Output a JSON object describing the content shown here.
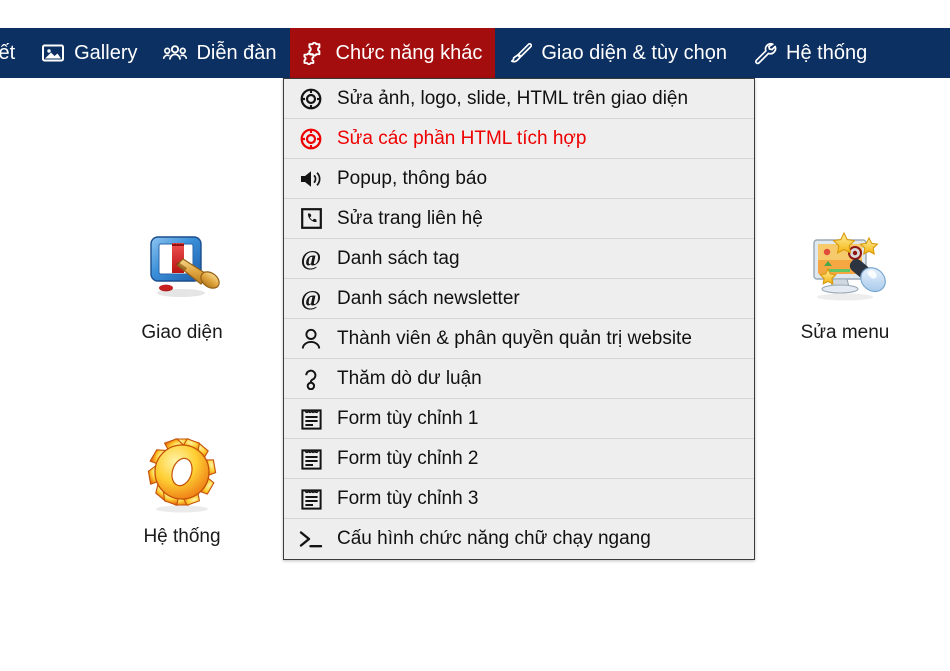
{
  "navbar": {
    "background_color": "#0d3062",
    "active_color": "#a40d0d",
    "items": [
      {
        "label": "iết",
        "icon": "none",
        "active": false
      },
      {
        "label": "Gallery",
        "icon": "image-icon",
        "active": false
      },
      {
        "label": "Diễn đàn",
        "icon": "users-icon",
        "active": false
      },
      {
        "label": "Chức năng khác",
        "icon": "puzzle-icon",
        "active": true
      },
      {
        "label": "Giao diện & tùy chọn",
        "icon": "brush-icon",
        "active": false
      },
      {
        "label": "Hệ thống",
        "icon": "wrench-icon",
        "active": false
      }
    ]
  },
  "dropdown": {
    "owner": "Chức năng khác",
    "highlight_color": "#ee0000",
    "items": [
      {
        "label": "Sửa ảnh, logo, slide, HTML trên giao diện",
        "icon": "lifebuoy-icon",
        "highlighted": false
      },
      {
        "label": "Sửa các phần HTML tích hợp",
        "icon": "lifebuoy-icon",
        "highlighted": true
      },
      {
        "label": "Popup, thông báo",
        "icon": "speaker-icon",
        "highlighted": false
      },
      {
        "label": "Sửa trang liên hệ",
        "icon": "phone-box-icon",
        "highlighted": false
      },
      {
        "label": "Danh sách tag",
        "icon": "at-icon",
        "highlighted": false
      },
      {
        "label": "Danh sách newsletter",
        "icon": "at-icon",
        "highlighted": false
      },
      {
        "label": "Thành viên & phân quyền quản trị website",
        "icon": "person-icon",
        "highlighted": false
      },
      {
        "label": "Thăm dò dư luận",
        "icon": "poll-icon",
        "highlighted": false
      },
      {
        "label": "Form tùy chỉnh 1",
        "icon": "form-icon",
        "highlighted": false
      },
      {
        "label": "Form tùy chỉnh 2",
        "icon": "form-icon",
        "highlighted": false
      },
      {
        "label": "Form tùy chỉnh 3",
        "icon": "form-icon",
        "highlighted": false
      },
      {
        "label": "Cấu hình chức năng chữ chạy ngang",
        "icon": "terminal-icon",
        "highlighted": false
      }
    ]
  },
  "shortcuts": [
    {
      "label": "Giao diện",
      "icon": "monitor-paintbrush-icon"
    },
    {
      "label": "Hệ thống",
      "icon": "gear-icon"
    },
    {
      "label": "Sửa menu",
      "icon": "monitor-stars-wand-icon"
    }
  ]
}
